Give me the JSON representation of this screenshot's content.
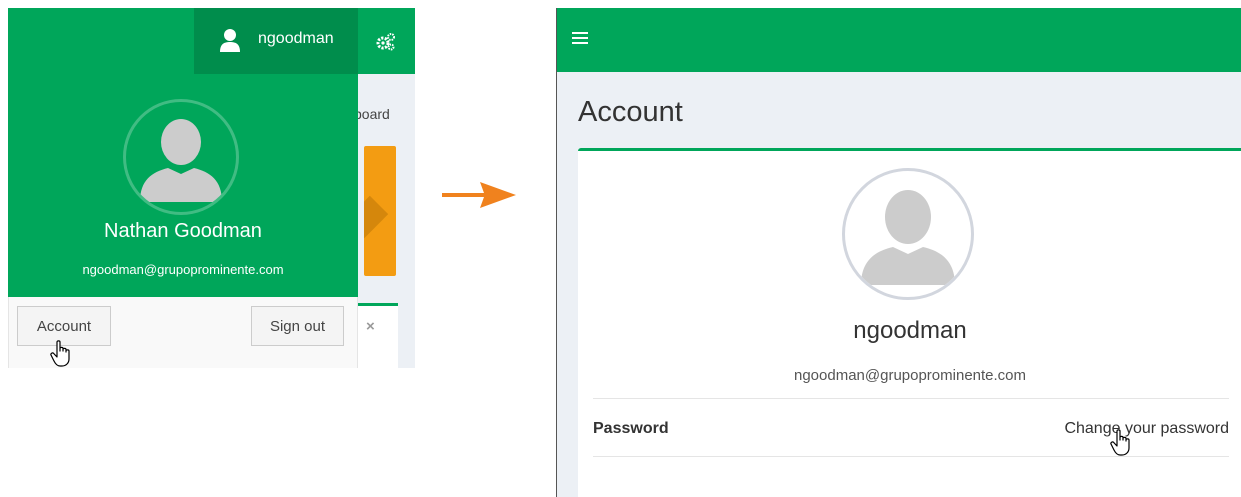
{
  "left_panel": {
    "topbar": {
      "username": "ngoodman",
      "user_icon": "user-icon",
      "gears_icon": "gears-icon"
    },
    "dashboard_breadcrumb_partial": "board",
    "dropdown": {
      "full_name": "Nathan Goodman",
      "email": "ngoodman@grupoprominente.com",
      "account_button": "Account",
      "signout_button": "Sign out"
    },
    "close_icon": "×"
  },
  "right_panel": {
    "menu_icon": "hamburger-icon",
    "page_title": "Account",
    "profile": {
      "username": "ngoodman",
      "email": "ngoodman@grupoprominente.com"
    },
    "password_row": {
      "label": "Password",
      "link": "Change your password"
    }
  },
  "colors": {
    "brand_green": "#00a65a",
    "brand_green_dark": "#008d4c",
    "warning_orange": "#f39c12",
    "arrow_orange": "#f0821e"
  }
}
